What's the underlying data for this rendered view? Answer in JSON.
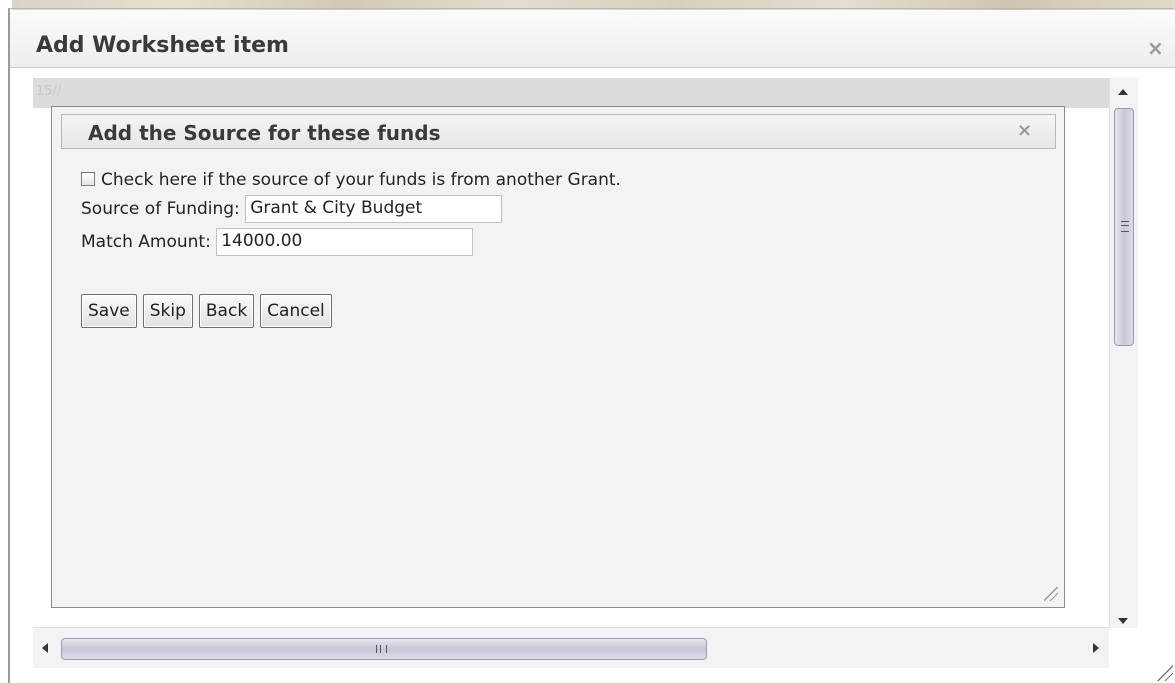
{
  "outer_dialog": {
    "title": "Add Worksheet item",
    "close_glyph": "×",
    "faint_text": "15//"
  },
  "inner_dialog": {
    "title": "Add the Source for these funds",
    "close_glyph": "×"
  },
  "form": {
    "grant_checkbox_label": "Check here if the source of your funds is from another Grant.",
    "grant_checkbox_checked": false,
    "source_label": "Source of Funding:",
    "source_value": "Grant & City Budget",
    "match_label": "Match Amount:",
    "match_value": "14000.00"
  },
  "buttons": {
    "save": "Save",
    "skip": "Skip",
    "back": "Back",
    "cancel": "Cancel"
  },
  "scrollbars": {
    "vertical_grip": "≡",
    "horizontal_grip": "III"
  }
}
